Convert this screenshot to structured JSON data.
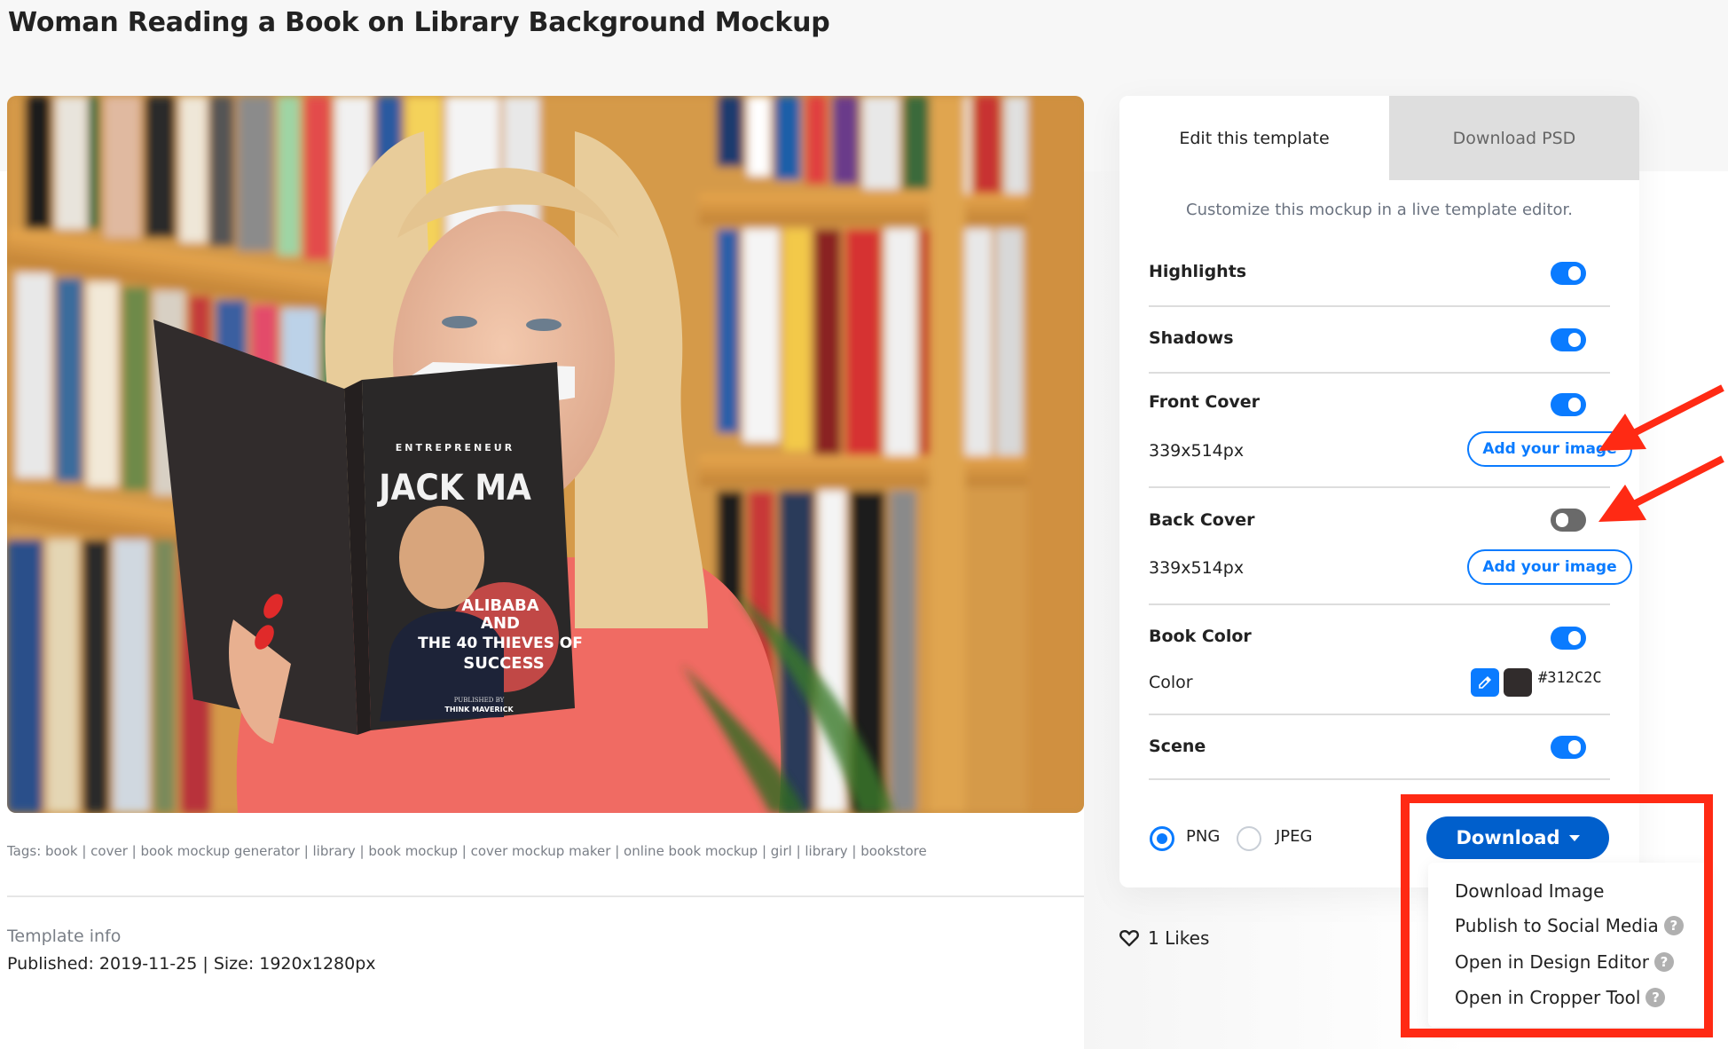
{
  "page": {
    "title": "Woman Reading a Book on Library Background Mockup"
  },
  "preview": {
    "alt": "Woman reading a book in front of library bookshelves",
    "book": {
      "kicker": "ENTREPRENEUR",
      "title": "JACK MA",
      "subtitle_lines": [
        "ALIBABA",
        "AND",
        "THE 40 THIEVES OF",
        "SUCCESS"
      ],
      "publisher_label": "PUBLISHED BY",
      "publisher": "THINK MAVERICK"
    }
  },
  "tags": {
    "text": "Tags: book | cover | book mockup generator | library | book mockup | cover mockup maker | online book mockup | girl | library | bookstore"
  },
  "template_info": {
    "label": "Template info",
    "value": "Published: 2019-11-25 | Size: 1920x1280px"
  },
  "panel": {
    "tabs": [
      {
        "label": "Edit this template",
        "active": true
      },
      {
        "label": "Download PSD",
        "active": false
      }
    ],
    "description": "Customize this mockup in a live template editor.",
    "options": {
      "highlights": {
        "label": "Highlights",
        "enabled": true
      },
      "shadows": {
        "label": "Shadows",
        "enabled": true
      },
      "front_cover": {
        "label": "Front Cover",
        "enabled": true,
        "size": "339x514px",
        "button": "Add your image"
      },
      "back_cover": {
        "label": "Back Cover",
        "enabled": false,
        "size": "339x514px",
        "button": "Add your image"
      },
      "book_color": {
        "label": "Book Color",
        "enabled": true,
        "color_label": "Color",
        "color_value": "#312C2C"
      },
      "scene": {
        "label": "Scene",
        "enabled": true
      }
    },
    "format": {
      "options": [
        "PNG",
        "JPEG"
      ],
      "selected": "PNG"
    },
    "download": {
      "label": "Download",
      "menu": [
        {
          "label": "Download Image",
          "help": false
        },
        {
          "label": "Publish to Social Media",
          "help": true
        },
        {
          "label": "Open in Design Editor",
          "help": true
        },
        {
          "label": "Open in Cropper Tool",
          "help": true
        }
      ]
    }
  },
  "likes": {
    "text": "1 Likes"
  },
  "colors": {
    "accent": "#0a7bff",
    "download_button": "#005fcc",
    "toggle_off": "#6a6a6a",
    "annotation": "#ff2a14",
    "book_color": "#312C2C"
  }
}
